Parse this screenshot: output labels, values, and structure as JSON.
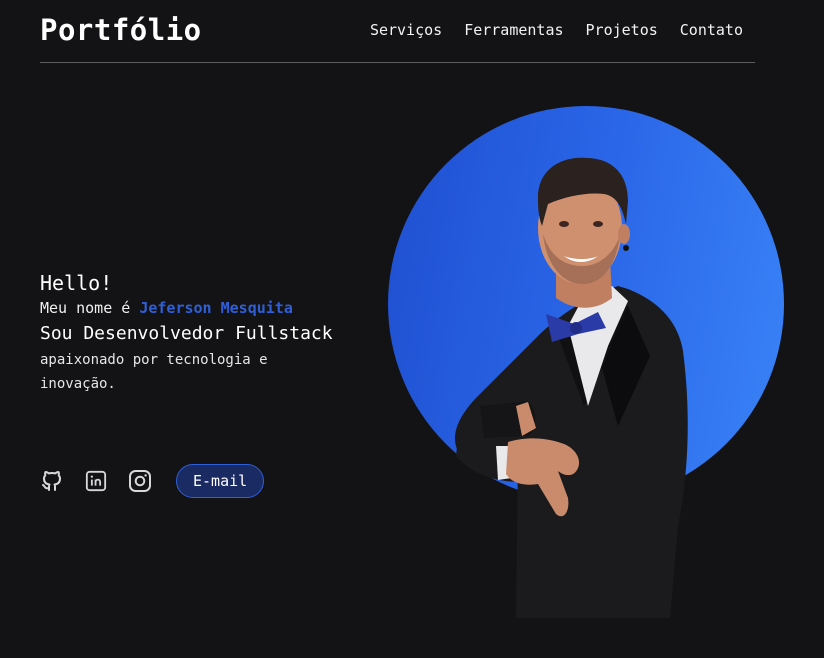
{
  "header": {
    "logo": "Portfólio",
    "nav": [
      "Serviços",
      "Ferramentas",
      "Projetos",
      "Contato"
    ]
  },
  "intro": {
    "greeting": "Hello!",
    "name_prefix": "Meu nome é",
    "name": "Jeferson Mesquita",
    "role": "Sou Desenvolvedor Fullstack",
    "description": "apaixonado por tecnologia e inovação."
  },
  "socials": {
    "icons": [
      "github-icon",
      "linkedin-icon",
      "instagram-icon"
    ],
    "email_label": "E-mail"
  },
  "colors": {
    "background": "#131315",
    "accent": "#2f5fd8",
    "circle_start": "#1f4fd0",
    "circle_end": "#3a83f7",
    "email_button_bg": "#1a2a63"
  }
}
